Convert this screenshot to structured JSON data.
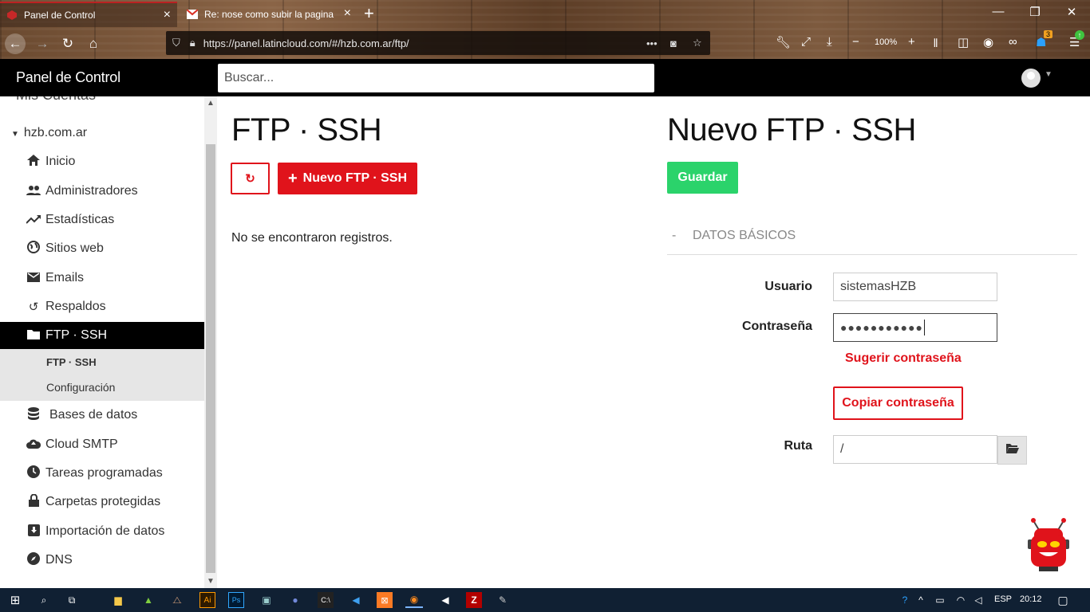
{
  "browser": {
    "tabs": [
      {
        "title": "Panel de Control",
        "icon": "latincloud-favicon"
      },
      {
        "title": "Re: nose como subir la pagina",
        "icon": "gmail-favicon"
      }
    ],
    "new_tab": "+",
    "url": "https://panel.latincloud.com/#/hzb.com.ar/ftp/",
    "zoom": "100%",
    "badge_count": "3"
  },
  "app": {
    "title": "Panel de Control",
    "search_placeholder": "Buscar..."
  },
  "sidebar": {
    "section_title": "Mis Cuentas",
    "domain": "hzb.com.ar",
    "items": [
      {
        "label": "Inicio",
        "icon": "home-icon"
      },
      {
        "label": "Administradores",
        "icon": "people-icon"
      },
      {
        "label": "Estadísticas",
        "icon": "trending-icon"
      },
      {
        "label": "Sitios web",
        "icon": "globe-icon"
      },
      {
        "label": "Emails",
        "icon": "mail-icon"
      },
      {
        "label": "Respaldos",
        "icon": "restore-icon"
      },
      {
        "label": "FTP · SSH",
        "icon": "folder-icon"
      },
      {
        "label": "Bases de datos",
        "icon": "database-icon"
      },
      {
        "label": "Cloud SMTP",
        "icon": "cloud-upload-icon"
      },
      {
        "label": "Tareas programadas",
        "icon": "clock-icon"
      },
      {
        "label": "Carpetas protegidas",
        "icon": "lock-icon"
      },
      {
        "label": "Importación de datos",
        "icon": "import-icon"
      },
      {
        "label": "DNS",
        "icon": "compass-icon"
      }
    ],
    "subitems": [
      "FTP · SSH",
      "Configuración"
    ]
  },
  "ftp_list": {
    "title": "FTP · SSH",
    "new_button": "Nuevo FTP · SSH",
    "empty_message": "No se encontraron registros."
  },
  "new_ftp": {
    "title": "Nuevo FTP · SSH",
    "save_button": "Guardar",
    "section_label": "DATOS BÁSICOS",
    "section_toggle": "-",
    "usuario_label": "Usuario",
    "usuario_value": "sistemasHZB",
    "password_label": "Contraseña",
    "password_value": "●●●●●●●●●●●",
    "suggest_link": "Sugerir contraseña",
    "copy_button": "Copiar contraseña",
    "ruta_label": "Ruta",
    "ruta_value": "/"
  },
  "taskbar": {
    "lang": "ESP",
    "time": "20:12"
  },
  "colors": {
    "accent_red": "#e0131b",
    "save_green": "#2bd36b",
    "header_black": "#000000",
    "taskbar": "#102033"
  }
}
